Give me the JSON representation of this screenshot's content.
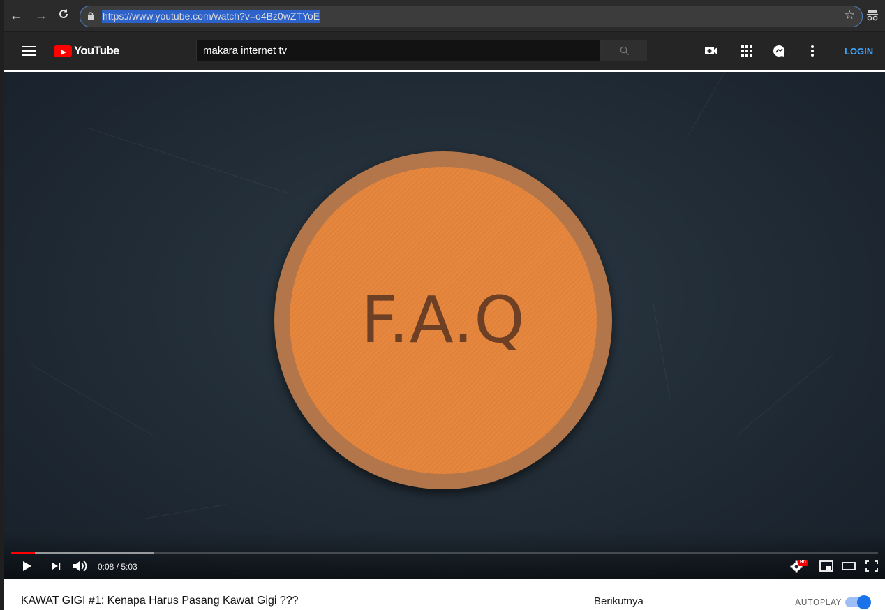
{
  "browser": {
    "url": "https://www.youtube.com/watch?v=o4Bz0wZTYoE"
  },
  "header": {
    "logo_text": "YouTube",
    "search_value": "makara internet tv",
    "login_label": "LOGIN"
  },
  "player": {
    "overlay_text": "F.A.Q",
    "time_display": "0:08 / 5:03",
    "played_fraction": 0.027,
    "loaded_fraction": 0.165,
    "hd_badge": "HD"
  },
  "below": {
    "video_title": "KAWAT GIGI #1: Kenapa Harus Pasang Kawat Gigi ???",
    "next_label": "Berikutnya",
    "autoplay_label": "AUTOPLAY",
    "autoplay_on": true
  },
  "colors": {
    "brand_red": "#ff0000",
    "link_blue": "#3ea6ff",
    "faq_orange": "#e6873f"
  }
}
